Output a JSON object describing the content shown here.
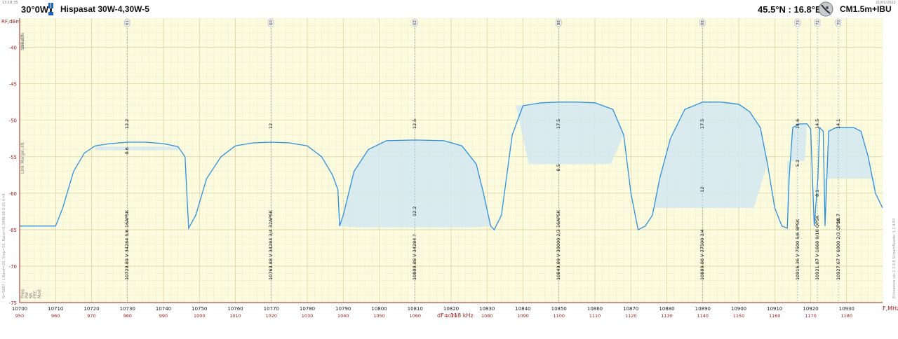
{
  "header": {
    "time": "13:18:35",
    "date": "21/01/2022",
    "position": "30°0W",
    "satellite": "Hispasat 30W-4,30W-5",
    "location": "45.5°N : 16.8°E",
    "antenna": "CM1.5m+IBU"
  },
  "left_info": "N=5687 / L Band=20, Step=10, Raise=0.3448 00 0:31 K=8",
  "right_info": "Elmeasure ver.2.3.0.8 StreamReader 1.2.4.83",
  "df_label": "dF= 118 kHz",
  "chart_data": {
    "type": "line",
    "ylabel": "RF,dBm",
    "xlabel": "F,MHz",
    "left_axis_labels": [
      "Level,%",
      "SNR,dB",
      "Link Margin,dB"
    ],
    "bottom_row_labels": [
      "Freq",
      "Pol",
      "SR",
      "FEC",
      "Mod"
    ],
    "ylim": [
      -75,
      -36
    ],
    "yticks": [
      -40,
      -45,
      -50,
      -55,
      -60,
      -65,
      -70,
      -75
    ],
    "xlim": [
      10700,
      10940
    ],
    "xticks": [
      10700,
      10710,
      10720,
      10730,
      10740,
      10750,
      10760,
      10770,
      10780,
      10790,
      10800,
      10810,
      10820,
      10830,
      10840,
      10850,
      10860,
      10870,
      10880,
      10890,
      10900,
      10910,
      10920,
      10930
    ],
    "if_ticks": [
      950,
      960,
      970,
      980,
      990,
      1000,
      1010,
      1020,
      1030,
      1040,
      1050,
      1060,
      1070,
      1080,
      1090,
      1100,
      1110,
      1120,
      1130,
      1140,
      1150,
      1160,
      1170,
      1180
    ],
    "grid": true,
    "series": [
      {
        "x": [
          10700,
          10705,
          10710,
          10712,
          10715,
          10718,
          10721,
          10725,
          10730,
          10735,
          10740,
          10744,
          10746,
          10746.5,
          10747,
          10749,
          10752,
          10756,
          10760,
          10765,
          10770,
          10775,
          10780,
          10784,
          10787,
          10788.5,
          10789,
          10790,
          10793,
          10797,
          10802,
          10810,
          10818,
          10823,
          10827,
          10829,
          10831,
          10832,
          10834,
          10837,
          10840,
          10845,
          10850,
          10855,
          10860,
          10865,
          10868,
          10870,
          10872,
          10874,
          10876,
          10878,
          10881,
          10885,
          10890,
          10895,
          10900,
          10903,
          10906,
          10908,
          10910,
          10912,
          10913.5,
          10914,
          10915,
          10917,
          10918,
          10919,
          10920,
          10920.5,
          10921,
          10922,
          10922.5,
          10923.5,
          10924,
          10925,
          10927,
          10930,
          10932,
          10934,
          10936,
          10938,
          10940
        ],
        "y": [
          -64.5,
          -64.5,
          -64.5,
          -62,
          -57,
          -54.5,
          -53.5,
          -53.2,
          -53,
          -53,
          -53.2,
          -53.6,
          -55,
          -60,
          -64.8,
          -63,
          -58,
          -55,
          -53.5,
          -53.1,
          -53,
          -53.1,
          -53.5,
          -55,
          -57.5,
          -59.5,
          -64.5,
          -63,
          -57,
          -54,
          -52.8,
          -52.7,
          -52.8,
          -53.5,
          -56,
          -60,
          -64.5,
          -65,
          -63,
          -52,
          -48,
          -47.6,
          -47.5,
          -47.5,
          -47.6,
          -48.5,
          -52,
          -60,
          -65,
          -64.5,
          -63,
          -58,
          -52.5,
          -48.5,
          -47.5,
          -47.5,
          -47.8,
          -48.8,
          -51,
          -56,
          -62,
          -64.5,
          -64.8,
          -58,
          -51,
          -50.5,
          -50.5,
          -50.5,
          -51.2,
          -58,
          -64.5,
          -58,
          -51,
          -51.5,
          -64.5,
          -51.5,
          -51,
          -51,
          -51,
          -51.5,
          -55,
          -60,
          -62
        ]
      }
    ],
    "transponders": [
      {
        "freq": 10729.89,
        "pol": "V",
        "sr": 34284,
        "fec": "5/6",
        "mod": "16APSK",
        "level": "61",
        "snr": "12.2",
        "margin": "0.6",
        "text": "10729.89  V  34284 5/6  16APSK"
      },
      {
        "freq": 10769.88,
        "pol": "V",
        "sr": 34284,
        "fec": "3/4",
        "mod": "32APSK",
        "level": "60",
        "snr": "12",
        "margin": "",
        "text": "10769.88  V  34284 3/4 32APSK"
      },
      {
        "freq": 10809.88,
        "pol": "V",
        "sr": 34284,
        "fec": "?",
        "mod": "",
        "level": "62",
        "snr": "12.5",
        "margin": "12.2",
        "text": "10809.88  V  34284  ?"
      },
      {
        "freq": 10849.89,
        "pol": "V",
        "sr": 30000,
        "fec": "2/3",
        "mod": "16APSK",
        "level": "88",
        "snr": "17.5",
        "margin": "8.5",
        "text": "10849.89  V  30000 2/3  16APSK"
      },
      {
        "freq": 10889.88,
        "pol": "V",
        "sr": 27500,
        "fec": "3/4",
        "mod": "",
        "level": "88",
        "snr": "17.5",
        "margin": "12",
        "text": "10889.88  V  27500 3/4"
      },
      {
        "freq": 10916.36,
        "pol": "V",
        "sr": 7500,
        "fec": "5/6",
        "mod": "8PSK",
        "level": "73",
        "snr": "14.6",
        "margin": "5.2",
        "text": "10916.36  V  7500 5/6  8PSK"
      },
      {
        "freq": 10921.87,
        "pol": "V",
        "sr": 1668,
        "fec": "9/10",
        "mod": "QPSK",
        "level": "72",
        "snr": "14.5",
        "margin": "8.1",
        "text": "10921.87  V  1668 9/10  QPSK"
      },
      {
        "freq": 10927.67,
        "pol": "V",
        "sr": 6000,
        "fec": "2/3",
        "mod": "QPSK",
        "level": "70",
        "snr": "14.1",
        "margin": "10.7",
        "text": "10927.67  V  6000 2/3  QPSK"
      }
    ],
    "colors": {
      "background": "#fbfbe0",
      "grid": "#e9d9a8",
      "trace": "#2f8fdc",
      "fill": "#d2e8f0",
      "axis_text": "#a02020"
    }
  }
}
